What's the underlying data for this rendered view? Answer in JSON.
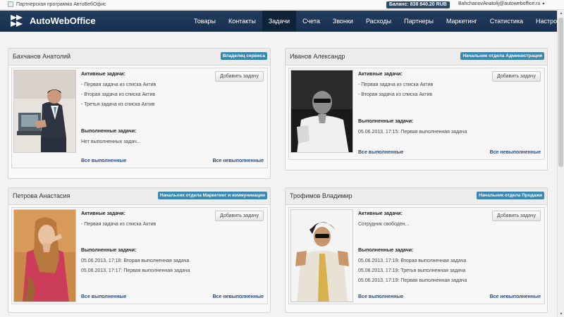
{
  "topbar": {
    "partner_text": "Партнерская программа АвтоВебОфис",
    "balance": "Баланс: 838 840.20 RUB",
    "user_email": "BahchanovAnatolij@autoweboffice.ru",
    "caret": "▾"
  },
  "brand": {
    "name": "AutoWebOffice"
  },
  "nav": {
    "items": [
      "Товары",
      "Контакты",
      "Задачи",
      "Счета",
      "Звонки",
      "Расходы",
      "Партнеры",
      "Маркетинг",
      "Статистика",
      "Настройки"
    ],
    "active": "Задачи"
  },
  "labels": {
    "active_tasks": "Активные задачи:",
    "done_tasks": "Выполненные задачи:",
    "add_task": "Добавить задачу",
    "all_done": "Все выполненные",
    "all_undone": "Все невыполненные"
  },
  "cards": [
    {
      "name": "Бахчанов Анатолий",
      "role": "Владелец сервиса",
      "active": [
        "- Первая задача из списка Актив",
        "- Вторая задача из списка Актив",
        "- Третья задача из списка Актив"
      ],
      "done": [
        "Нет выполненных задач..."
      ]
    },
    {
      "name": "Иванов Александр",
      "role": "Начальник отдела Администрация",
      "active": [
        "- Первая задача из списка Актив",
        "- Вторая задача из списка Актив"
      ],
      "done": [
        "05.06.2013, 17:15: Первая выполненная задача"
      ]
    },
    {
      "name": "Петрова Анастасия",
      "role": "Начальник отдела Маркетинг и коммуникации",
      "active": [
        "- Первая задача из списка Актив"
      ],
      "done": [
        "05.06.2013, 17:18: Вторая выполненная задача",
        "05.06.2013, 17:17: Первая выполненная задача"
      ]
    },
    {
      "name": "Трофимов Владимир",
      "role": "Начальник отдела Продажи",
      "active": [
        "Сотрудник свободен..."
      ],
      "done": [
        "05.06.2013, 17:19: Вторая выполненная задача",
        "05.06.2013, 17:19: Третья выполненная задача",
        "05.06.2013, 17:19: Первая выполненная задача"
      ]
    }
  ],
  "colors": {
    "navbar": "#1c3656",
    "nav_active": "#0e2238",
    "badge": "#3a88b0",
    "link": "#2a4a86"
  }
}
